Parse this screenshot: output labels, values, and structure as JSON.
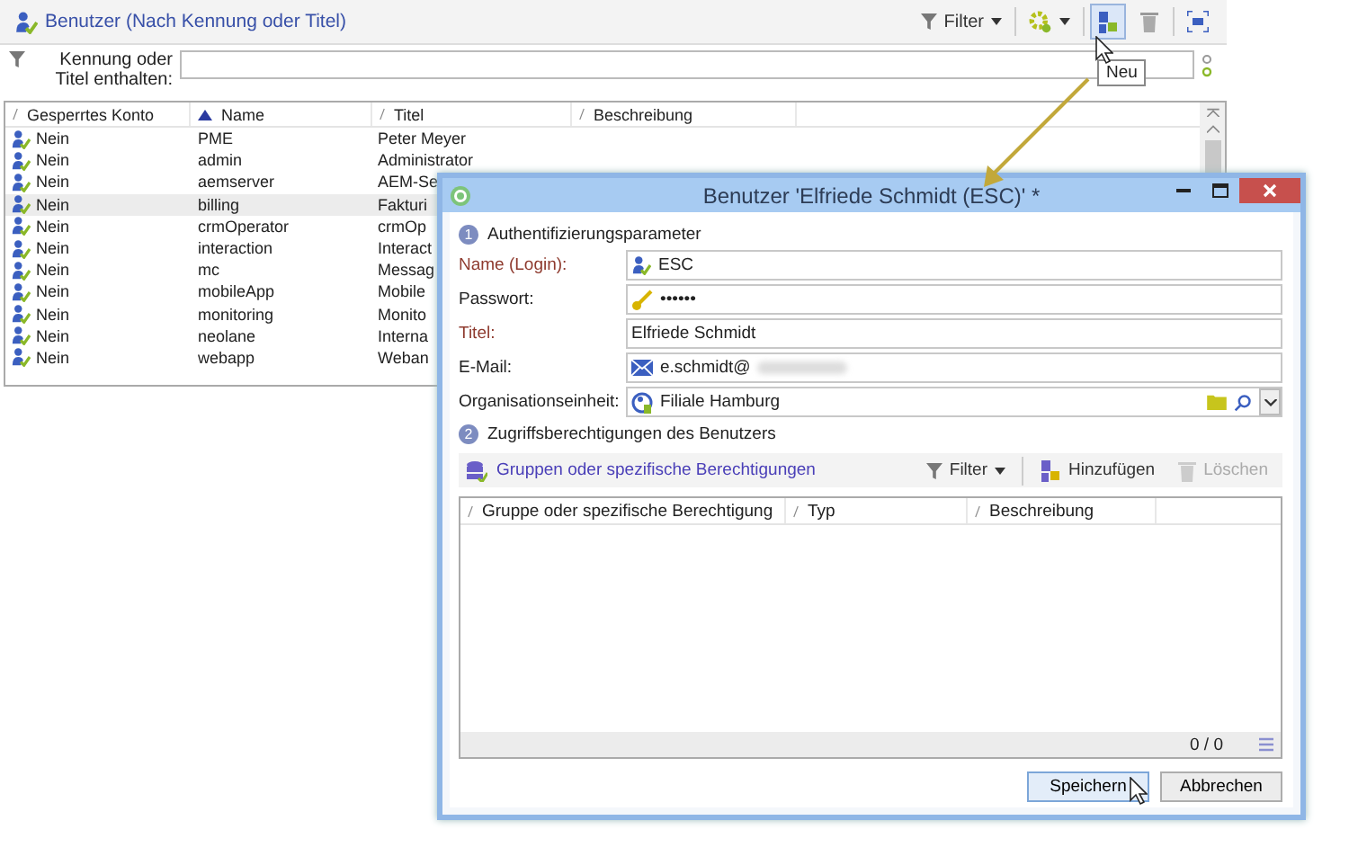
{
  "main_window": {
    "title": "Benutzer (Nach Kennung oder Titel)",
    "toolbar": [
      {
        "kind": "filter",
        "label": "Filter",
        "pressed": false
      },
      {
        "kind": "actions",
        "pressed": false
      },
      {
        "kind": "new",
        "pressed": true
      },
      {
        "kind": "delete",
        "pressed": false
      },
      {
        "kind": "fullscreen",
        "pressed": false
      }
    ],
    "tooltip": "Neu",
    "search": {
      "label": "Kennung oder Titel enthalten:"
    },
    "table": {
      "columns": [
        {
          "label": "Gesperrtes Konto",
          "sorted": false
        },
        {
          "label": "Name",
          "sorted": true
        },
        {
          "label": "Titel",
          "sorted": false
        },
        {
          "label": "Beschreibung",
          "sorted": false
        }
      ],
      "rows": [
        {
          "locked": "Nein",
          "name": "PME",
          "title": "Peter Meyer",
          "selected": false
        },
        {
          "locked": "Nein",
          "name": "admin",
          "title": "Administrator",
          "selected": false
        },
        {
          "locked": "Nein",
          "name": "aemserver",
          "title": "AEM-Se",
          "selected": false
        },
        {
          "locked": "Nein",
          "name": "billing",
          "title": "Fakturi",
          "selected": true
        },
        {
          "locked": "Nein",
          "name": "crmOperator",
          "title": "crmOp",
          "selected": false
        },
        {
          "locked": "Nein",
          "name": "interaction",
          "title": "Interact",
          "selected": false
        },
        {
          "locked": "Nein",
          "name": "mc",
          "title": "Messag",
          "selected": false
        },
        {
          "locked": "Nein",
          "name": "mobileApp",
          "title": "Mobile",
          "selected": false
        },
        {
          "locked": "Nein",
          "name": "monitoring",
          "title": "Monito",
          "selected": false
        },
        {
          "locked": "Nein",
          "name": "neolane",
          "title": "Interna",
          "selected": false
        },
        {
          "locked": "Nein",
          "name": "webapp",
          "title": "Weban",
          "selected": false
        }
      ]
    }
  },
  "dialog": {
    "title": "Benutzer 'Elfriede Schmidt (ESC)' *",
    "section_1": {
      "number": "1",
      "label": "Authentifizierungsparameter"
    },
    "fields": [
      {
        "kind": "login",
        "label": "Name (Login):",
        "value": "ESC",
        "required": true
      },
      {
        "kind": "password",
        "label": "Passwort:",
        "value": "••••••",
        "required": false
      },
      {
        "kind": "text",
        "label": "Titel:",
        "value": "Elfriede Schmidt",
        "required": true
      },
      {
        "kind": "email",
        "label": "E-Mail:",
        "value": "e.schmidt@",
        "required": false
      },
      {
        "kind": "org",
        "label": "Organisationseinheit:",
        "value": "Filiale Hamburg",
        "required": false
      }
    ],
    "section_2": {
      "number": "2",
      "label": "Zugriffsberechtigungen des Benutzers"
    },
    "grid_toolbar": {
      "link": "Gruppen oder spezifische Berechtigungen",
      "filter": "Filter",
      "add": "Hinzufügen",
      "delete": "Löschen",
      "delete_disabled": true
    },
    "grid": {
      "columns": [
        {
          "label": "Gruppe oder spezifische Berechtigung",
          "sorted": false
        },
        {
          "label": "Typ",
          "sorted": false
        },
        {
          "label": "Beschreibung",
          "sorted": false
        }
      ],
      "count": "0 / 0"
    },
    "buttons": [
      {
        "label": "Speichern",
        "default": true
      },
      {
        "label": "Abbrechen",
        "default": false
      }
    ]
  }
}
